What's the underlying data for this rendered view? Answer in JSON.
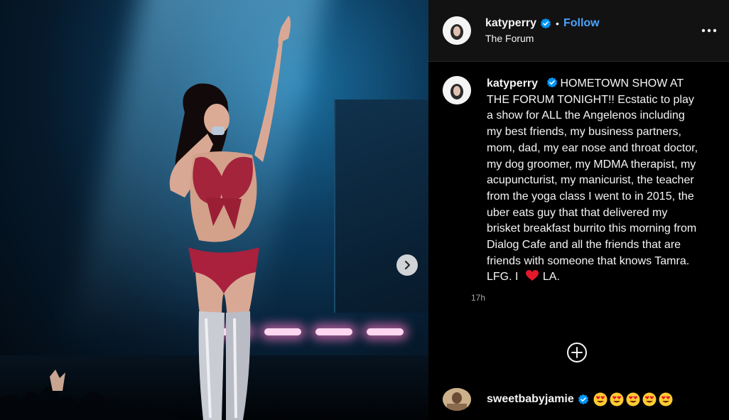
{
  "post": {
    "author": "katyperry",
    "follow_label": "Follow",
    "dot": "•",
    "location": "The Forum",
    "caption_text": "HOMETOWN SHOW AT THE FORUM TONIGHT!! Ecstatic to play a show for ALL the Angelenos including my best friends, my business partners, mom, dad, my ear nose and throat doctor, my dog groomer, my MDMA therapist, my acupuncturist, my manicurist, the teacher from the yoga class I went to in 2015, the uber eats guy that that delivered my brisket breakfast burrito this morning from Dialog Cafe and all the friends that are friends with someone that knows Tamra. LFG. I",
    "caption_end": "LA.",
    "caption_emoji": "red-heart-icon",
    "timestamp": "17h"
  },
  "comment": {
    "author": "sweetbabyjamie",
    "emoji": [
      "heart-eyes-icon",
      "heart-eyes-icon",
      "heart-eyes-icon",
      "heart-eyes-icon",
      "heart-eyes-icon"
    ]
  },
  "icons": {
    "verified": "verified-badge-icon",
    "more": "more-options-icon",
    "next": "chevron-right-icon",
    "add": "add-comment-icon"
  },
  "colors": {
    "accent": "#4aa3ff",
    "verified": "#0095f6",
    "background": "#000000",
    "header_bg": "#121212"
  }
}
